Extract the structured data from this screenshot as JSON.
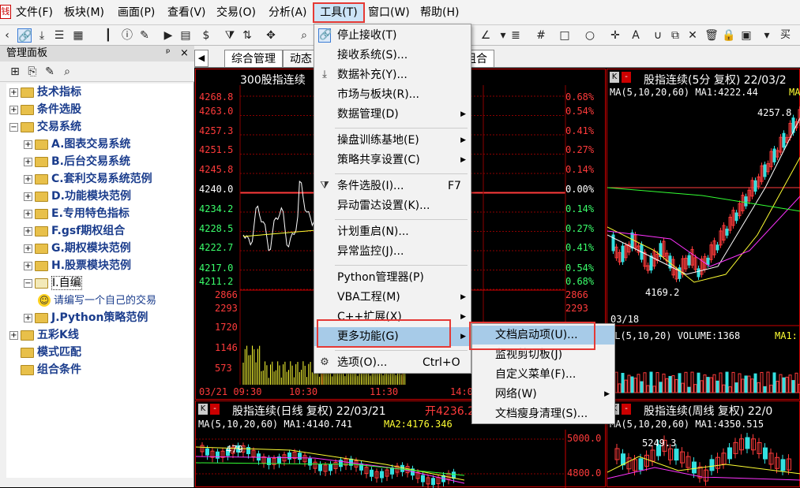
{
  "menubar": {
    "items": [
      "文件(F)",
      "板块(M)",
      "画面(P)",
      "查看(V)",
      "交易(O)",
      "分析(A)",
      "工具(T)",
      "窗口(W)",
      "帮助(H)"
    ]
  },
  "toolbar": {
    "dollar": "$",
    "icons": [
      "link-icon",
      "download-icon",
      "grid-icon",
      "candle-icon",
      "info-icon",
      "play-icon",
      "doc-icon",
      "dollar-icon",
      "filter-icon",
      "move-icon",
      "zoom-icon"
    ],
    "right_text": "买"
  },
  "panel": {
    "title": "管理面板",
    "pin": "ᵖ",
    "close": "×",
    "tree": [
      {
        "label": "技术指标",
        "level": 0,
        "expander": "+"
      },
      {
        "label": "条件选股",
        "level": 0,
        "expander": "+"
      },
      {
        "label": "交易系统",
        "level": 0,
        "expander": "−"
      },
      {
        "label": "A.图表交易系统",
        "level": 1,
        "expander": "+"
      },
      {
        "label": "B.后台交易系统",
        "level": 1,
        "expander": "+"
      },
      {
        "label": "C.套利交易系统范例",
        "level": 1,
        "expander": "+"
      },
      {
        "label": "D.功能模块范例",
        "level": 1,
        "expander": "+"
      },
      {
        "label": "E.专用特色指标",
        "level": 1,
        "expander": "+"
      },
      {
        "label": "F.gsf期权组合",
        "level": 1,
        "expander": "+"
      },
      {
        "label": "G.期权模块范例",
        "level": 1,
        "expander": "+"
      },
      {
        "label": "H.股票模块范例",
        "level": 1,
        "expander": "+"
      },
      {
        "label": "I.自编",
        "level": 1,
        "expander": "−"
      },
      {
        "label": "请编写一个自己的交易",
        "level": 2,
        "expander": ""
      },
      {
        "label": "J.Python策略范例",
        "level": 1,
        "expander": "+"
      },
      {
        "label": "五彩K线",
        "level": 0,
        "expander": "+"
      },
      {
        "label": "模式匹配",
        "level": 0,
        "expander": ""
      },
      {
        "label": "组合条件",
        "level": 0,
        "expander": ""
      }
    ]
  },
  "tabs": [
    "综合管理",
    "动态",
    "组合"
  ],
  "tools_menu": {
    "items": [
      {
        "label": "停止接收(T)",
        "icon": "link-icon",
        "shortcut": "",
        "arrow": false
      },
      {
        "label": "接收系统(S)...",
        "icon": "",
        "shortcut": "",
        "arrow": false
      },
      {
        "label": "数据补充(Y)...",
        "icon": "download-icon",
        "shortcut": "",
        "arrow": false
      },
      {
        "label": "市场与板块(R)...",
        "icon": "",
        "shortcut": "",
        "arrow": false
      },
      {
        "label": "数据管理(D)",
        "icon": "",
        "shortcut": "",
        "arrow": true
      },
      {
        "label": "操盘训练基地(E)",
        "icon": "",
        "shortcut": "",
        "arrow": true
      },
      {
        "label": "策略共享设置(C)",
        "icon": "",
        "shortcut": "",
        "arrow": true
      },
      {
        "label": "条件选股(I)...",
        "icon": "filter-icon",
        "shortcut": "F7",
        "arrow": false
      },
      {
        "label": "异动雷达设置(K)...",
        "icon": "",
        "shortcut": "",
        "arrow": false
      },
      {
        "label": "计划重启(N)...",
        "icon": "",
        "shortcut": "",
        "arrow": false
      },
      {
        "label": "异常监控(J)...",
        "icon": "",
        "shortcut": "",
        "arrow": false
      },
      {
        "label": "Python管理器(P)",
        "icon": "",
        "shortcut": "",
        "arrow": false
      },
      {
        "label": "VBA工程(M)",
        "icon": "",
        "shortcut": "",
        "arrow": true
      },
      {
        "label": "C++扩展(X)",
        "icon": "",
        "shortcut": "",
        "arrow": true
      },
      {
        "label": "更多功能(G)",
        "icon": "",
        "shortcut": "",
        "arrow": true
      },
      {
        "label": "选项(O)...",
        "icon": "gear-icon",
        "shortcut": "Ctrl+O",
        "arrow": false
      }
    ]
  },
  "more_menu": {
    "items": [
      {
        "label": "文档启动项(U)...",
        "arrow": false
      },
      {
        "label": "监视剪切板(J)",
        "arrow": false
      },
      {
        "label": "自定义菜单(F)...",
        "arrow": false
      },
      {
        "label": "网络(W)",
        "arrow": true
      },
      {
        "label": "文档瘦身清理(S)...",
        "arrow": false
      }
    ]
  },
  "intraday": {
    "title": "300股指连续",
    "left_prices": [
      "4268.8",
      "4263.0",
      "4257.3",
      "4251.5",
      "4245.8",
      "4240.0",
      "4234.2",
      "4228.5",
      "4222.7",
      "4217.0",
      "4211.2"
    ],
    "right_pcts": [
      "0.68%",
      "0.54%",
      "0.41%",
      "0.27%",
      "0.14%",
      "0.00%",
      "0.14%",
      "0.27%",
      "0.41%",
      "0.54%",
      "0.68%"
    ],
    "volume_left": [
      "2866",
      "2293",
      "1720",
      "1146",
      "573"
    ],
    "volume_right": [
      "2866",
      "2293"
    ],
    "time_axis": [
      "03/21 09:30",
      "10:30",
      "11:30",
      "14:0"
    ],
    "colors": {
      "up": "#ff3b3b",
      "down": "#3bff6b",
      "flat": "#ffffff"
    }
  },
  "chart_5min": {
    "k_label": "K",
    "title": "股指连续(5分 复权) 22/03/2",
    "ma_text": "MA(5,10,20,60) MA1:4222.44",
    "ma2_label": "MA",
    "high_label": "4257.8",
    "low_label": "4169.2",
    "date_label": "03/18",
    "vol_text": "OL(5,10,20) VOLUME:1368",
    "ma1_label": "MA1:"
  },
  "chart_daily": {
    "k_label": "K",
    "title": "股指连续(日线 复权) 22/03/21",
    "open_text": "开4236.2",
    "ma_text": "MA(5,10,20,60) MA1:4140.741",
    "ma2_text": "MA2:4176.346",
    "price_labels": [
      "5000.0",
      "4800.0"
    ],
    "point_label": "479"
  },
  "chart_weekly": {
    "k_label": "K",
    "title": "股指连续(周线 复权) 22/0",
    "ma_text": "MA(5,10,20,60) MA1:4350.515",
    "high_label": "5249.3"
  }
}
